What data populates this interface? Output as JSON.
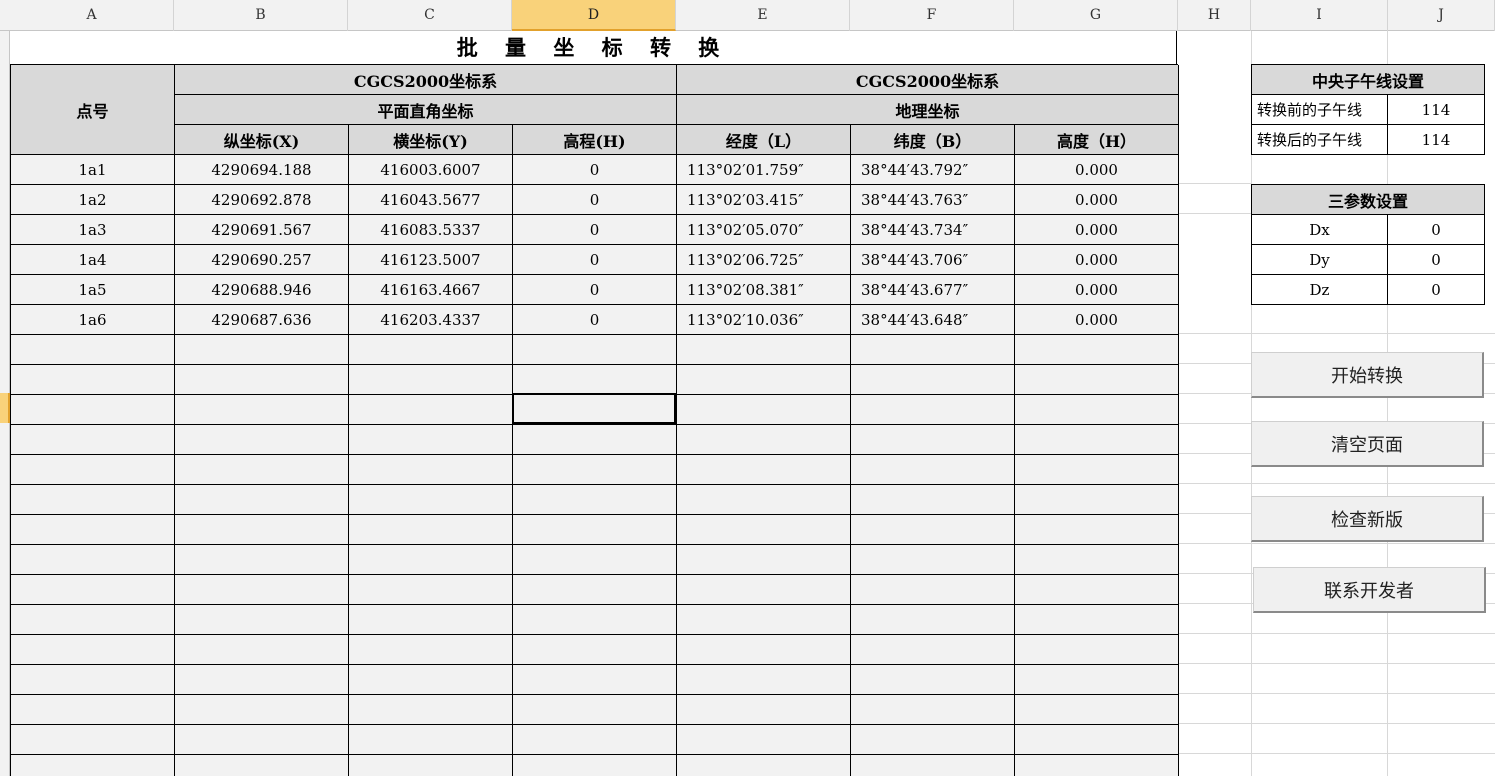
{
  "columns": [
    "A",
    "B",
    "C",
    "D",
    "E",
    "F",
    "G",
    "H",
    "I",
    "J"
  ],
  "selected_column": "D",
  "title": "批 量 坐 标 转 换",
  "header": {
    "point_no": "点号",
    "left_system": "CGCS2000坐标系",
    "left_sub": "平面直角坐标",
    "right_system": "CGCS2000坐标系",
    "right_sub": "地理坐标",
    "col_x": "纵坐标(X)",
    "col_y": "横坐标(Y)",
    "col_h": "高程(H)",
    "col_l": "经度（L）",
    "col_b": "纬度（B）",
    "col_hh": "高度（H）"
  },
  "rows": [
    {
      "id": "1a1",
      "x": "4290694.188",
      "y": "416003.6007",
      "h": "0",
      "l": "113°02′01.759″",
      "b": "38°44′43.792″",
      "hh": "0.000"
    },
    {
      "id": "1a2",
      "x": "4290692.878",
      "y": "416043.5677",
      "h": "0",
      "l": "113°02′03.415″",
      "b": "38°44′43.763″",
      "hh": "0.000"
    },
    {
      "id": "1a3",
      "x": "4290691.567",
      "y": "416083.5337",
      "h": "0",
      "l": "113°02′05.070″",
      "b": "38°44′43.734″",
      "hh": "0.000"
    },
    {
      "id": "1a4",
      "x": "4290690.257",
      "y": "416123.5007",
      "h": "0",
      "l": "113°02′06.725″",
      "b": "38°44′43.706″",
      "hh": "0.000"
    },
    {
      "id": "1a5",
      "x": "4290688.946",
      "y": "416163.4667",
      "h": "0",
      "l": "113°02′08.381″",
      "b": "38°44′43.677″",
      "hh": "0.000"
    },
    {
      "id": "1a6",
      "x": "4290687.636",
      "y": "416203.4337",
      "h": "0",
      "l": "113°02′10.036″",
      "b": "38°44′43.648″",
      "hh": "0.000"
    }
  ],
  "meridian": {
    "title": "中央子午线设置",
    "before_label": "转换前的子午线",
    "before_value": "114",
    "after_label": "转换后的子午线",
    "after_value": "114"
  },
  "params": {
    "title": "三参数设置",
    "dx_label": "Dx",
    "dx_value": "0",
    "dy_label": "Dy",
    "dy_value": "0",
    "dz_label": "Dz",
    "dz_value": "0"
  },
  "buttons": {
    "convert": "开始转换",
    "clear": "清空页面",
    "check": "检查新版",
    "contact": "联系开发者"
  }
}
